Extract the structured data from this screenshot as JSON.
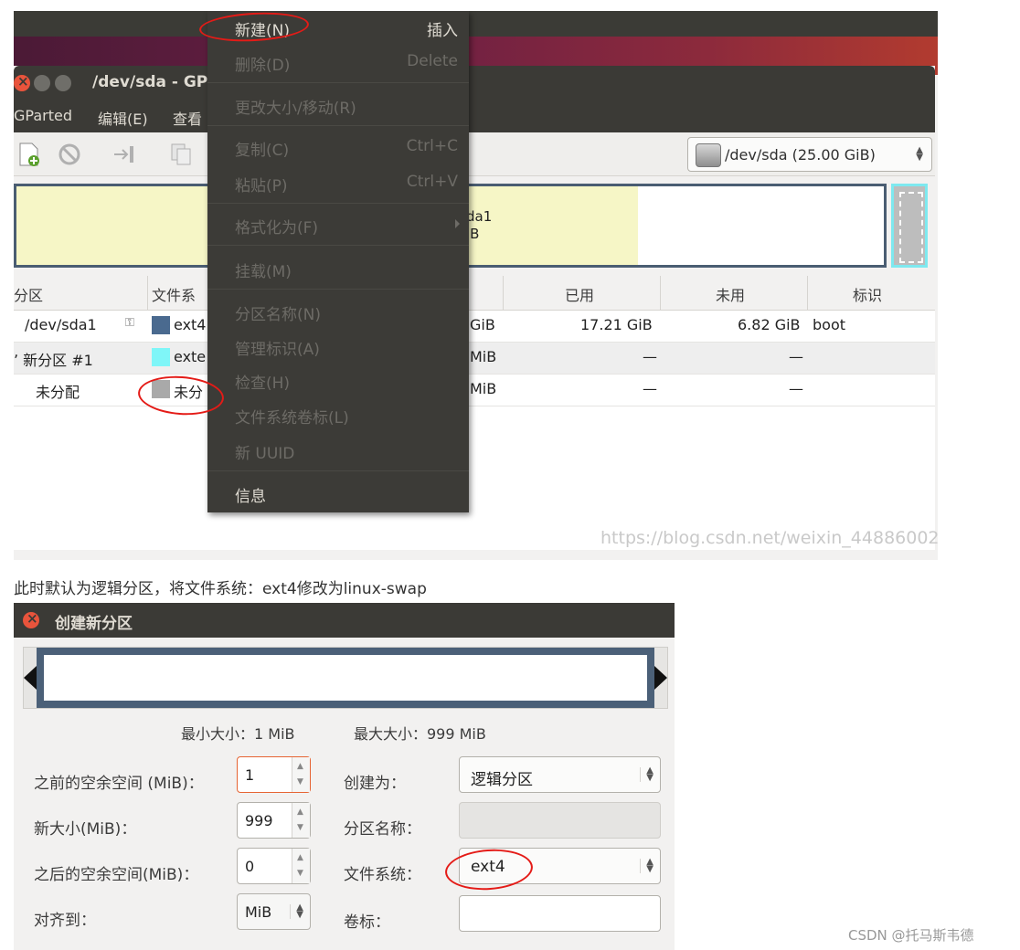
{
  "screenshot1": {
    "window_title": "/dev/sda - GP",
    "menubar": [
      "GParted",
      "编辑(E)",
      "查看"
    ],
    "device_selector": "/dev/sda  (25.00 GiB)",
    "partition_map": {
      "label_line1": "da1",
      "label_line2": "iB"
    },
    "table": {
      "headers": [
        "分区",
        "文件系",
        "已用",
        "未用",
        "标识"
      ],
      "rows": [
        {
          "partition": "/dev/sda1",
          "fs": "ext4",
          "fs_color": "#4a6a8f",
          "size": "GiB",
          "used": "17.21 GiB",
          "unused": "6.82 GiB",
          "flags": "boot"
        },
        {
          "partition": "新分区 #1",
          "fs": "exte",
          "fs_color": "#7ff6f8",
          "size": "MiB",
          "used": "—",
          "unused": "—",
          "flags": ""
        },
        {
          "partition": "未分配",
          "fs": "未分",
          "fs_color": "#a9a9a9",
          "size": "MiB",
          "used": "—",
          "unused": "—",
          "flags": ""
        }
      ]
    },
    "context_menu": [
      {
        "label": "新建(N)",
        "accel": "插入",
        "enabled": true
      },
      {
        "label": "删除(D)",
        "accel": "Delete",
        "enabled": false
      },
      {
        "label": "更改大小/移动(R)",
        "accel": "",
        "enabled": false
      },
      {
        "label": "复制(C)",
        "accel": "Ctrl+C",
        "enabled": false
      },
      {
        "label": "粘贴(P)",
        "accel": "Ctrl+V",
        "enabled": false
      },
      {
        "label": "格式化为(F)",
        "accel": "",
        "enabled": false
      },
      {
        "label": "挂载(M)",
        "accel": "",
        "enabled": false
      },
      {
        "label": "分区名称(N)",
        "accel": "",
        "enabled": false
      },
      {
        "label": "管理标识(A)",
        "accel": "",
        "enabled": false
      },
      {
        "label": "检查(H)",
        "accel": "",
        "enabled": false
      },
      {
        "label": "文件系统卷标(L)",
        "accel": "",
        "enabled": false
      },
      {
        "label": "新 UUID",
        "accel": "",
        "enabled": false
      },
      {
        "label": "信息",
        "accel": "",
        "enabled": true
      }
    ],
    "watermark": "https://blog.csdn.net/weixin_44886002"
  },
  "caption": "此时默认为逻辑分区，将文件系统：ext4修改为linux-swap",
  "dialog": {
    "title": "创建新分区",
    "min_size": "最小大小：1 MiB",
    "max_size": "最大大小：999 MiB",
    "free_before_label": "之前的空余空间 (MiB)：",
    "free_before_value": "1",
    "new_size_label": "新大小(MiB)：",
    "new_size_value": "999",
    "free_after_label": "之后的空余空间(MiB)：",
    "free_after_value": "0",
    "align_label": "对齐到：",
    "align_value": "MiB",
    "create_as_label": "创建为：",
    "create_as_value": "逻辑分区",
    "part_name_label": "分区名称：",
    "part_name_value": "",
    "filesystem_label": "文件系统：",
    "filesystem_value": "ext4",
    "volume_label_label": "卷标：",
    "volume_label_value": ""
  },
  "credit": "CSDN @托马斯韦德",
  "colors": {
    "titlebar": "#3b3a36",
    "close": "#e9543c",
    "annotation": "#e41b17",
    "partition_outline": "#4a5d72"
  }
}
